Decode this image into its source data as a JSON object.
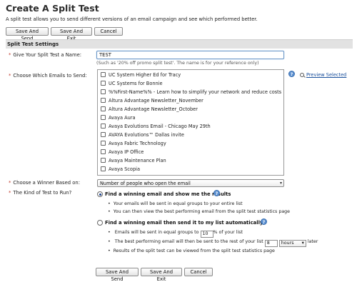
{
  "page": {
    "title": "Create A Split Test",
    "intro": "A split test allows you to send different versions of an email campaign and see which performed better."
  },
  "buttons": {
    "save_and_send": "Save And Send",
    "save_and_exit": "Save And Exit",
    "cancel": "Cancel"
  },
  "section": {
    "title": "Split Test Settings"
  },
  "name_field": {
    "label": "Give Your Split Test a Name:",
    "value": "TEST",
    "hint": "(Such as '20% off promo split test'. The name is for your reference only)"
  },
  "emails_field": {
    "label": "Choose Which Emails to Send:",
    "preview_label": "Preview Selected",
    "items": [
      "UC System Higher Ed for Tracy",
      "UC Systems for Bonnie",
      "%%First-Name%% - Learn how to simplify your network and reduce costs",
      "Altura Advantage Newsletter_November",
      "Altura Advantage Newsletter_October",
      "Avaya Aura",
      "Avaya Evolutions Email - Chicago May 29th",
      "AVAYA Evolutions™ Dallas invite",
      "Avaya Fabric Technology",
      "Avaya IP Office",
      "Avaya Maintenance Plan",
      "Avaya Scopia"
    ]
  },
  "winner_field": {
    "label": "Choose a Winner Based on:",
    "selected": "Number of people who open the email"
  },
  "test_kind": {
    "label": "The Kind of Test to Run?",
    "option1": {
      "title": "Find a winning email and show me the results",
      "bullet1": "Your emails will be sent in equal groups to your entire list",
      "bullet2": "You can then view the best performing email from the split test statistics page"
    },
    "option2": {
      "title": "Find a winning email then send it to my list automatically",
      "bullet1_pre": "Emails will be sent in equal groups to",
      "percent_value": "10",
      "bullet1_post": "% of your list",
      "bullet2_pre": "The best performing email will then be sent to the rest of your list",
      "delay_value": "8",
      "delay_unit": "hours",
      "bullet2_post": "later",
      "bullet3": "Results of the split test can be viewed from the split test statistics page"
    }
  },
  "icons": {
    "help": "help-question-icon",
    "preview": "magnifier-icon",
    "dropdown": "chevron-down-icon"
  },
  "colors": {
    "link": "#1a4f9c",
    "required": "#c0392b",
    "help_icon": "#5a8fd0",
    "section_bg": "#e2e2e2"
  }
}
